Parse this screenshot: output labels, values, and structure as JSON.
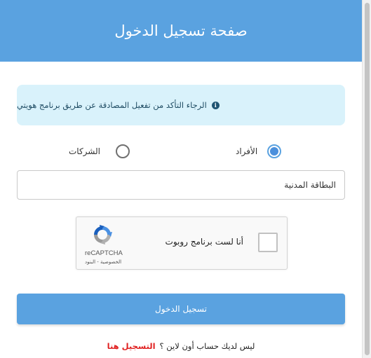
{
  "header": {
    "title": "صفحة تسجيل الدخول"
  },
  "alert": {
    "icon": "info-icon",
    "text": "الرجاء التأكد من تفعيل المصادقة عن طريق برنامج هويتي"
  },
  "login_type": {
    "individuals_label": "الأفراد",
    "companies_label": "الشركات",
    "selected": "individuals"
  },
  "id_field": {
    "placeholder": "البطاقة المدنية",
    "value": ""
  },
  "captcha": {
    "label": "أنا لست برنامج روبوت",
    "brand": "reCAPTCHA",
    "terms": "الخصوصية - البنود",
    "checked": false,
    "logo_icon": "recaptcha-logo-icon"
  },
  "login_button": {
    "label": "تسجيل الدخول"
  },
  "footer": {
    "question": "ليس لديك حساب أون لاين ؟",
    "register_label": "التسجيل هنا"
  },
  "colors": {
    "primary": "#5aa2e0",
    "alert_bg": "#d9f2fb",
    "link": "#e02020"
  }
}
